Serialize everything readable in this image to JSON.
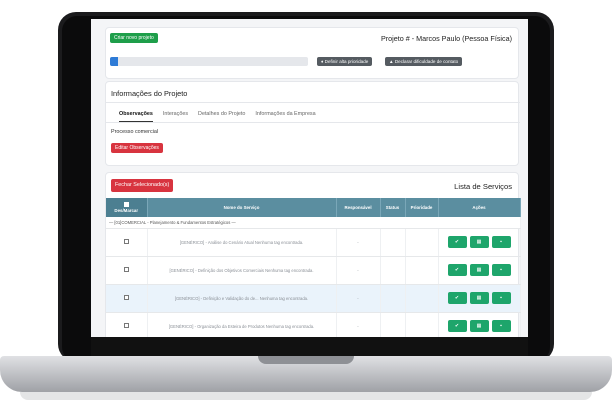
{
  "header": {
    "new_project_label": "Criar novo projeto",
    "project_title": "Projeto # - Marcos Paulo (Pessoa Física)",
    "progress_fraction": 0.04,
    "priority_button": "Definir alta prioridade",
    "difficulty_button": "Declarar dificuldade de contato"
  },
  "info": {
    "title": "Informações do Projeto",
    "tabs": [
      "Observações",
      "Interações",
      "Detalhes do Projeto",
      "Informações da Empresa"
    ],
    "active_tab": 0,
    "body_text": "Processo comercial",
    "edit_button": "Editar Observações"
  },
  "services": {
    "close_selected_button": "Fechar Selecionado(s)",
    "list_title": "Lista de Serviços",
    "columns": [
      "Des/Marcar",
      "Nome do Serviço",
      "Responsável",
      "Status",
      "Prioridade",
      "Ações"
    ],
    "group_label": "— [01]COMERCIAL - Planejamento & Fundamentos Estratégicos —",
    "rows": [
      {
        "name": "[GENÉRICO] - Análise do Cenário Atual Nenhuma tag encontrada.",
        "responsavel": "-"
      },
      {
        "name": "[GENÉRICO] - Definição dos Objetivos Comerciais Nenhuma tag encontrada.",
        "responsavel": "-"
      },
      {
        "name": "[GENÉRICO] - Definição e Validação do de... Nenhuma tag encontrada.",
        "responsavel": "-"
      },
      {
        "name": "[GENÉRICO] - Organização da Esteira de Produtos Nenhuma tag encontrada.",
        "responsavel": "-"
      }
    ],
    "action_icons": [
      "check-icon",
      "calendar-icon",
      "grid-icon"
    ]
  }
}
